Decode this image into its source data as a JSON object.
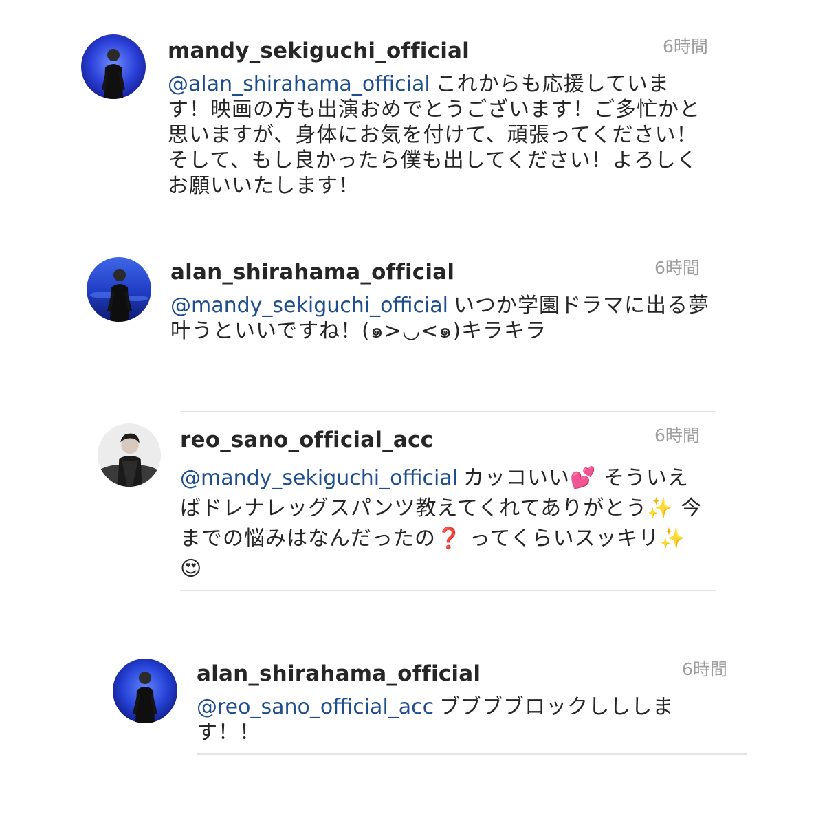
{
  "comments": [
    {
      "username": "mandy_sekiguchi_official",
      "time": "6時間",
      "mention": "@alan_shirahama_official",
      "text": "これからも応援しています！映画の方も出演おめでとうございます！ご多忙かと思いますが、身体にお気を付けて、頑張ってください！そして、もし良かったら僕も出してください！よろしくお願いいたします！"
    },
    {
      "username": "alan_shirahama_official",
      "time": "6時間",
      "mention": "@mandy_sekiguchi_official",
      "text": "いつか学園ドラマに出る夢叶うといいですね！(๑>◡<๑)キラキラ"
    },
    {
      "username": "reo_sano_official_acc",
      "time": "6時間",
      "mention": "@mandy_sekiguchi_official",
      "text": "カッコいい💕 そういえばドレナレッグスパンツ教えてくれてありがとう✨ 今までの悩みはなんだったの❓ ってくらいスッキリ✨ 😍"
    },
    {
      "username": "alan_shirahama_official",
      "time": "6時間",
      "mention": "@reo_sano_official_acc",
      "text": "ブブブブロックしししま す！！"
    }
  ]
}
